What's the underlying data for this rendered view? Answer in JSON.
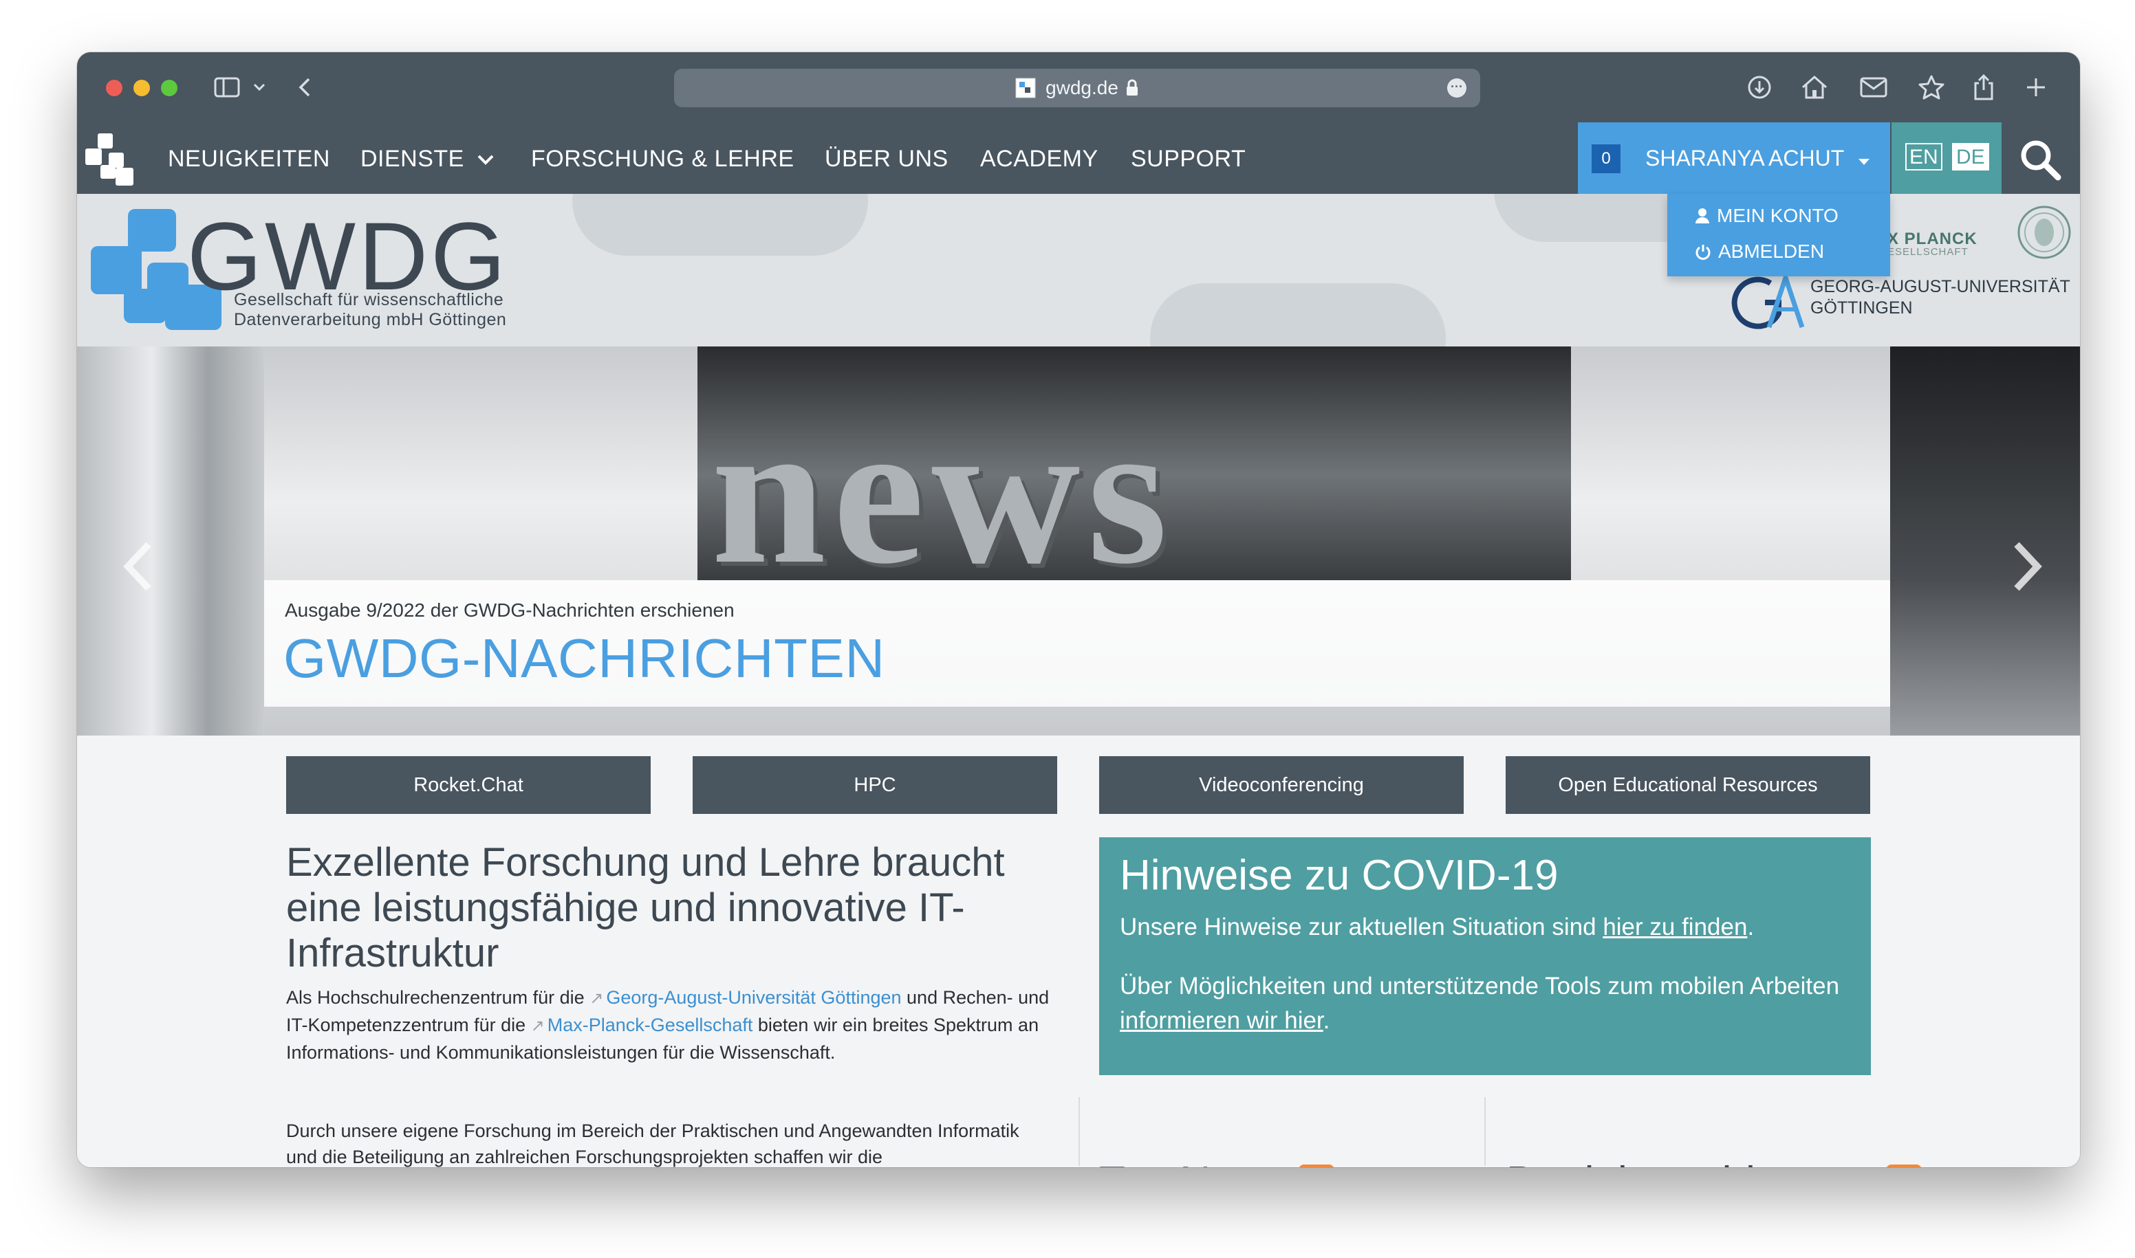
{
  "browser": {
    "url_display": "gwdg.de",
    "icons": [
      "sidebar-icon",
      "chevron-down-icon",
      "back-icon",
      "download-icon",
      "home-icon",
      "mail-icon",
      "star-icon",
      "share-icon",
      "plus-icon",
      "lock-icon",
      "more-icon"
    ]
  },
  "nav": {
    "items": [
      "NEUIGKEITEN",
      "DIENSTE",
      "FORSCHUNG & LEHRE",
      "ÜBER UNS",
      "ACADEMY",
      "SUPPORT"
    ],
    "cart_count": "0",
    "user_name": "SHARANYA ACHUT",
    "lang_en": "EN",
    "lang_de": "DE"
  },
  "user_menu": {
    "account": "MEIN KONTO",
    "logout": "ABMELDEN"
  },
  "header": {
    "logo_word": "GWDG",
    "logo_sub_1": "Gesellschaft für wissenschaftliche",
    "logo_sub_2": "Datenverarbeitung mbH Göttingen",
    "mpg_text": "X PLANCK",
    "mpg_sub": "ESELLSCHAFT",
    "goe_line_1": "GEORG-AUGUST-UNIVERSITÄT",
    "goe_line_2": "GÖTTINGEN"
  },
  "slider": {
    "image_word": "news",
    "caption_small": "Ausgabe 9/2022 der GWDG-Nachrichten erschienen",
    "caption_title": "GWDG-NACHRICHTEN"
  },
  "quick_links": [
    "Rocket.Chat",
    "HPC",
    "Videoconferencing",
    "Open Educational Resources"
  ],
  "intro": {
    "title": "Exzellente Forschung und Lehre braucht eine leistungsfähige und innovative IT-Infrastruktur",
    "p1_a": "Als Hochschulrechenzentrum für die ",
    "p1_link1": "Georg-August-Universität Göttingen",
    "p1_b": " und Rechen- und IT-Kompetenzzentrum für die ",
    "p1_link2": "Max-Planck-Gesellschaft",
    "p1_c": " bieten wir ein breites Spektrum an Informations- und Kommunikationsleistungen für die Wissenschaft.",
    "p2": "Durch unsere eigene Forschung im Bereich der Praktischen und Angewandten Informatik und die Beteiligung an zahlreichen Forschungsprojekten schaffen wir die"
  },
  "covid": {
    "title": "Hinweise zu COVID-19",
    "p1_text": "Unsere Hinweise zur aktuellen Situation sind ",
    "p1_link": "hier zu finden",
    "p1_end": ".",
    "p2_text": "Über Möglichkeiten und unterstützende Tools zum mobilen Arbeiten ",
    "p2_link": "informieren wir hier",
    "p2_end": "."
  },
  "columns": {
    "top_news": "Top News",
    "betrieb": "Betriebsmeldungen"
  },
  "colors": {
    "nav_bg": "#49555f",
    "accent_blue": "#4a9fe0",
    "teal": "#4f9ea1",
    "rss_orange": "#f08a3c"
  }
}
